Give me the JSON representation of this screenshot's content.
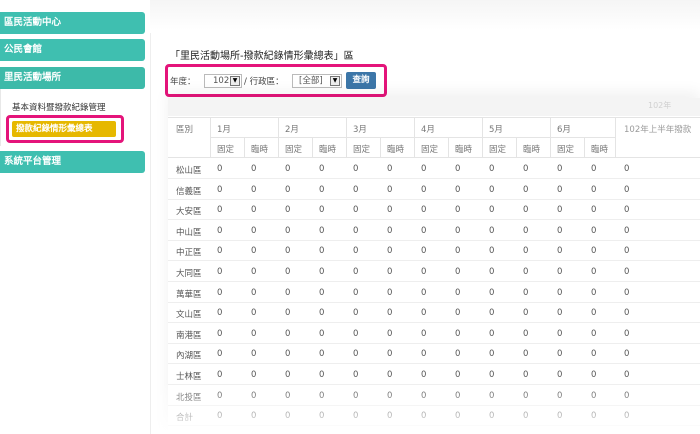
{
  "sidebar": {
    "items": [
      {
        "label": "區民活動中心"
      },
      {
        "label": "公民會館"
      },
      {
        "label": "里民活動場所"
      },
      {
        "label": "系統平台管理"
      }
    ],
    "submenu": [
      {
        "label": "基本資料暨撥款紀錄管理"
      },
      {
        "label": "撥款紀錄情形彙總表"
      }
    ]
  },
  "page": {
    "title": "「里民活動場所-撥款紀錄情形彙總表」區"
  },
  "filter": {
    "year_label": "年度：",
    "year_value": "102",
    "district_label": "/ 行政區：",
    "district_value": "[全部]",
    "query_label": "查詢",
    "arrow": "▼"
  },
  "table": {
    "caption": "102年",
    "district_header": "區別",
    "months": [
      "1月",
      "2月",
      "3月",
      "4月",
      "5月",
      "6月"
    ],
    "half_year_header": "102年上半年撥款",
    "sub_headers": [
      "固定",
      "臨時"
    ],
    "rows": [
      {
        "district": "松山區",
        "values": [
          "0",
          "0",
          "0",
          "0",
          "0",
          "0",
          "0",
          "0",
          "0",
          "0",
          "0",
          "0",
          "0"
        ]
      },
      {
        "district": "信義區",
        "values": [
          "0",
          "0",
          "0",
          "0",
          "0",
          "0",
          "0",
          "0",
          "0",
          "0",
          "0",
          "0",
          "0"
        ]
      },
      {
        "district": "大安區",
        "values": [
          "0",
          "0",
          "0",
          "0",
          "0",
          "0",
          "0",
          "0",
          "0",
          "0",
          "0",
          "0",
          "0"
        ]
      },
      {
        "district": "中山區",
        "values": [
          "0",
          "0",
          "0",
          "0",
          "0",
          "0",
          "0",
          "0",
          "0",
          "0",
          "0",
          "0",
          "0"
        ]
      },
      {
        "district": "中正區",
        "values": [
          "0",
          "0",
          "0",
          "0",
          "0",
          "0",
          "0",
          "0",
          "0",
          "0",
          "0",
          "0",
          "0"
        ]
      },
      {
        "district": "大同區",
        "values": [
          "0",
          "0",
          "0",
          "0",
          "0",
          "0",
          "0",
          "0",
          "0",
          "0",
          "0",
          "0",
          "0"
        ]
      },
      {
        "district": "萬華區",
        "values": [
          "0",
          "0",
          "0",
          "0",
          "0",
          "0",
          "0",
          "0",
          "0",
          "0",
          "0",
          "0",
          "0"
        ]
      },
      {
        "district": "文山區",
        "values": [
          "0",
          "0",
          "0",
          "0",
          "0",
          "0",
          "0",
          "0",
          "0",
          "0",
          "0",
          "0",
          "0"
        ]
      },
      {
        "district": "南港區",
        "values": [
          "0",
          "0",
          "0",
          "0",
          "0",
          "0",
          "0",
          "0",
          "0",
          "0",
          "0",
          "0",
          "0"
        ]
      },
      {
        "district": "內湖區",
        "values": [
          "0",
          "0",
          "0",
          "0",
          "0",
          "0",
          "0",
          "0",
          "0",
          "0",
          "0",
          "0",
          "0"
        ]
      },
      {
        "district": "士林區",
        "values": [
          "0",
          "0",
          "0",
          "0",
          "0",
          "0",
          "0",
          "0",
          "0",
          "0",
          "0",
          "0",
          "0"
        ]
      },
      {
        "district": "北投區",
        "values": [
          "0",
          "0",
          "0",
          "0",
          "0",
          "0",
          "0",
          "0",
          "0",
          "0",
          "0",
          "0",
          "0"
        ]
      },
      {
        "district": "合計",
        "values": [
          "0",
          "0",
          "0",
          "0",
          "0",
          "0",
          "0",
          "0",
          "0",
          "0",
          "0",
          "0",
          "0"
        ]
      }
    ]
  },
  "colors": {
    "sidebar_header": "#3fbfb0",
    "active_submenu": "#e6b800",
    "highlight": "#e4147a",
    "query_button": "#3c76a8"
  }
}
